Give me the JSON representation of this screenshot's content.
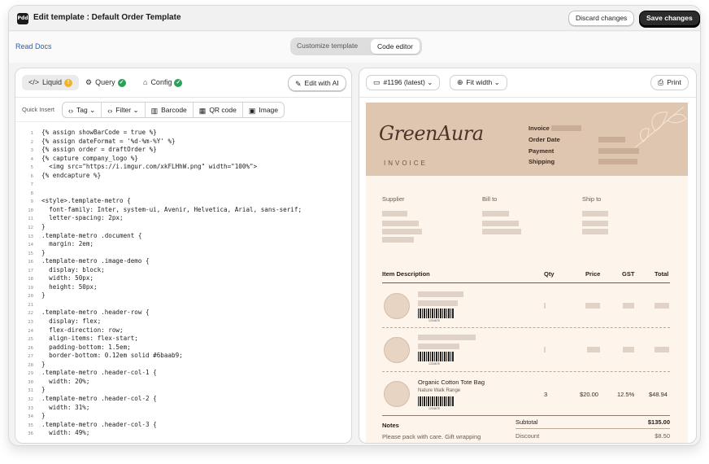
{
  "topbar": {
    "logo_text": "Pdd",
    "title": "Edit template : Default Order Template",
    "discard_label": "Discard changes",
    "save_label": "Save changes"
  },
  "subbar": {
    "read_docs": "Read Docs",
    "segments": [
      "Customize template",
      "Code editor"
    ],
    "active_segment": "Code editor"
  },
  "editor": {
    "tabs": [
      {
        "label": "Liquid",
        "status": "warning"
      },
      {
        "label": "Query",
        "status": "ok"
      },
      {
        "label": "Config",
        "status": "ok"
      }
    ],
    "edit_ai_label": "Edit with AI",
    "quick_insert_label": "Quick Insert",
    "quick_insert_buttons": [
      "Tag",
      "Filter",
      "Barcode",
      "QR code",
      "Image"
    ],
    "code_lines": [
      "{% assign showBarCode = true %}",
      "{% assign dateFormat = '%d-%m-%Y' %}",
      "{% assign order = draftOrder %}",
      "{% capture company_logo %}",
      "  <img src=\"https://i.imgur.com/xkFLHhW.png\" width=\"100%\">",
      "{% endcapture %}",
      "",
      "",
      "<style>.template-metro {",
      "  font-family: Inter, system-ui, Avenir, Helvetica, Arial, sans-serif;",
      "  letter-spacing: 2px;",
      "}",
      ".template-metro .document {",
      "  margin: 2em;",
      "}",
      ".template-metro .image-demo {",
      "  display: block;",
      "  width: 50px;",
      "  height: 50px;",
      "}",
      "",
      ".template-metro .header-row {",
      "  display: flex;",
      "  flex-direction: row;",
      "  align-items: flex-start;",
      "  padding-bottom: 1.5em;",
      "  border-bottom: 0.12em solid #6baab9;",
      "}",
      ".template-metro .header-col-1 {",
      "  width: 20%;",
      "}",
      ".template-metro .header-col-2 {",
      "  width: 31%;",
      "}",
      ".template-metro .header-col-3 {",
      "  width: 49%;"
    ]
  },
  "preview_toolbar": {
    "version_label": "#1196 (latest)",
    "fit_label": "Fit width",
    "print_label": "Print"
  },
  "invoice": {
    "brand": "GreenAura",
    "invoice_word": "INVOICE",
    "meta_labels": [
      "Invoice",
      "Order Date",
      "Payment",
      "Shipping"
    ],
    "parties": [
      "Supplier",
      "Bill to",
      "Ship to"
    ],
    "columns": [
      "Item Description",
      "Qty",
      "Price",
      "GST",
      "Total"
    ],
    "barcode_caption": "1234678",
    "item3": {
      "name": "Organic Cotton Tote Bag",
      "vendor": "Nature Walk Range",
      "qty": "3",
      "price": "$20.00",
      "gst": "12.5%",
      "total": "$48.94"
    },
    "notes_label": "Notes",
    "notes_text": "Please pack with care. Gift wrapping",
    "subtotal_label": "Subtotal",
    "subtotal_value": "$135.00",
    "discount_label": "Discount",
    "discount_value": "$8.50"
  },
  "colors": {
    "accent_dark": "#2b2b2b",
    "link": "#2c5ea8",
    "invoice_header": "#dfc6b0",
    "invoice_bg": "#fdf4ec",
    "status_ok": "#2e9e5b",
    "status_warning": "#f0b429"
  }
}
